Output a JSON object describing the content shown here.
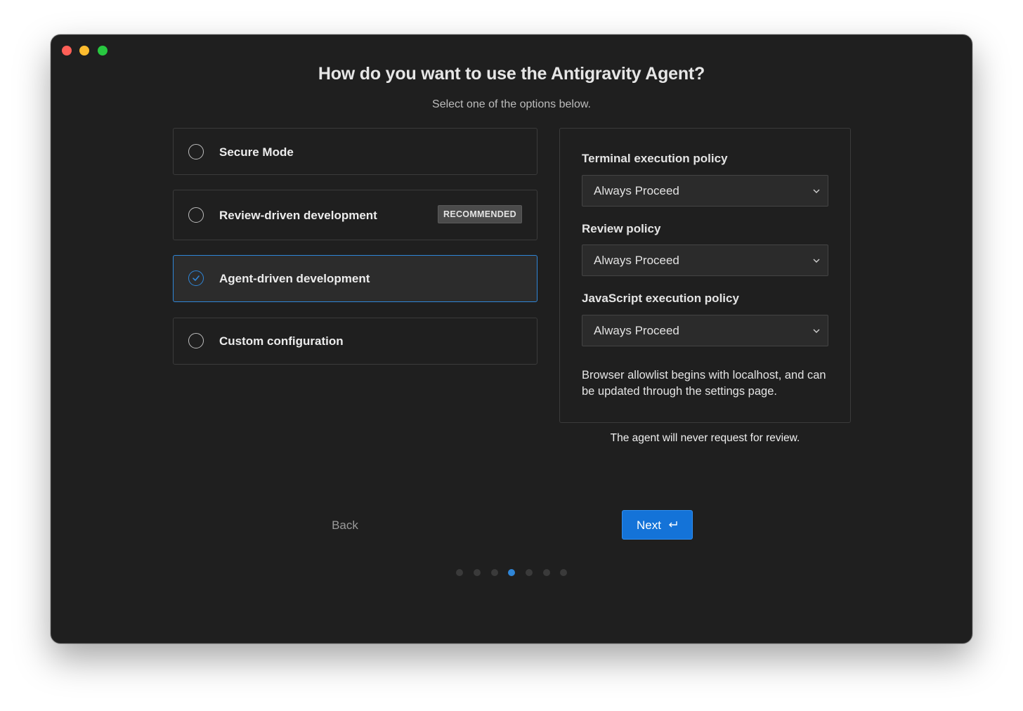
{
  "dialog": {
    "title": "How do you want to use the Antigravity Agent?",
    "subtitle": "Select one of the options below."
  },
  "options": [
    {
      "label": "Secure Mode",
      "selected": false
    },
    {
      "label": "Review-driven development",
      "selected": false,
      "badge": "RECOMMENDED"
    },
    {
      "label": "Agent-driven development",
      "selected": true
    },
    {
      "label": "Custom configuration",
      "selected": false
    }
  ],
  "policies": {
    "terminal": {
      "label": "Terminal execution policy",
      "value": "Always Proceed"
    },
    "review": {
      "label": "Review policy",
      "value": "Always Proceed"
    },
    "javascript": {
      "label": "JavaScript execution policy",
      "value": "Always Proceed"
    },
    "note": "Browser allowlist begins with localhost, and can be updated through the settings page."
  },
  "footnote": "The agent will never request for review.",
  "nav": {
    "back_label": "Back",
    "next_label": "Next"
  },
  "steps": {
    "total": 7,
    "current": 4
  },
  "colors": {
    "accent": "#2f86d8",
    "primary_button": "#1473d8",
    "window_bg": "#1f1f1f"
  }
}
